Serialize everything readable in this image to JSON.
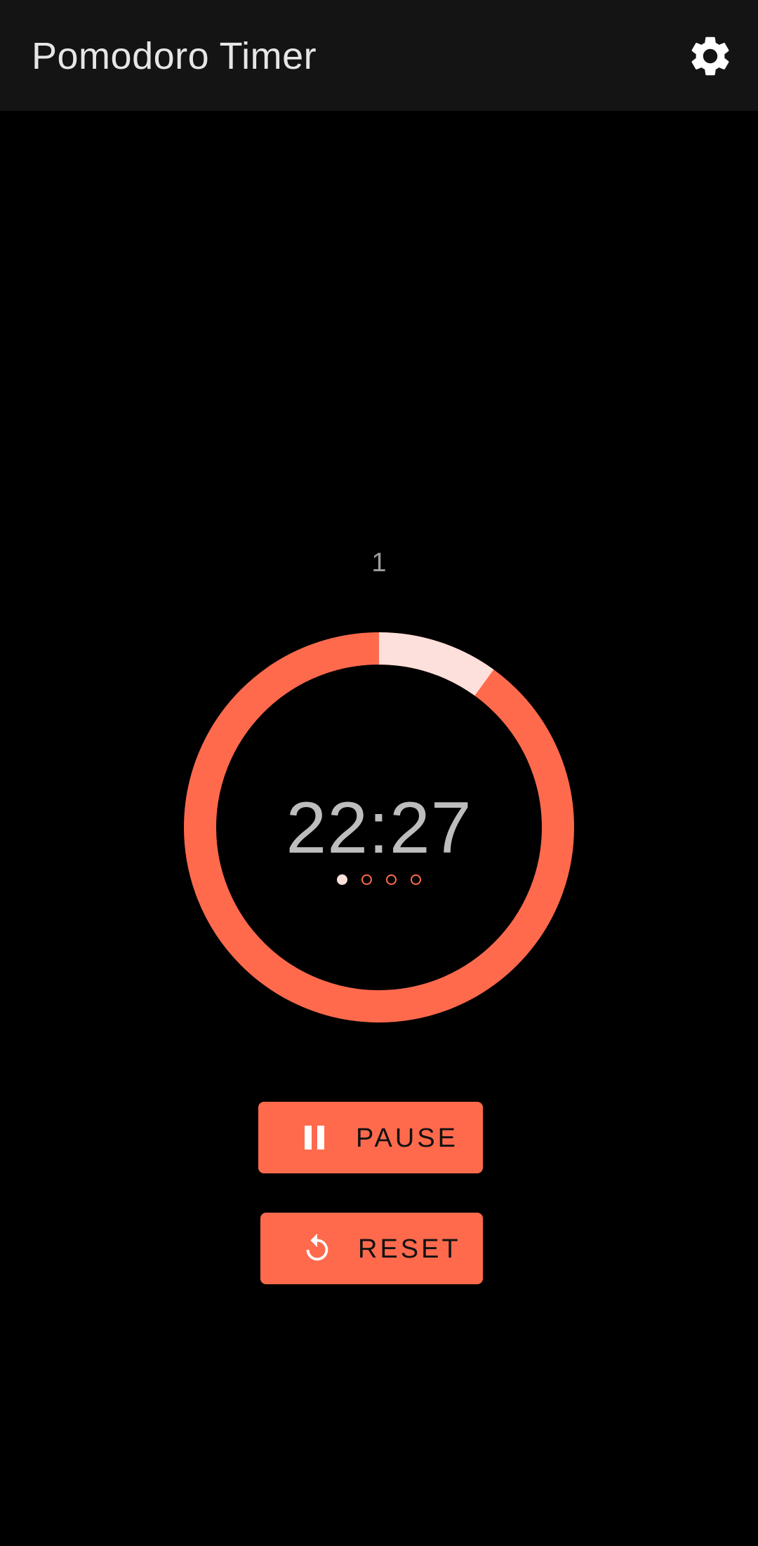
{
  "app": {
    "title": "Pomodoro Timer"
  },
  "icons": {
    "settings": "gear-icon",
    "pause": "pause-icon",
    "reset": "refresh-icon"
  },
  "timer": {
    "session_number": "1",
    "time_remaining": "22:27",
    "elapsed_fraction": 0.1,
    "session_dots": [
      {
        "active": true
      },
      {
        "active": false
      },
      {
        "active": false
      },
      {
        "active": false
      }
    ]
  },
  "controls": {
    "pause_label": "PAUSE",
    "reset_label": "RESET"
  },
  "colors": {
    "accent": "#ff6a4d",
    "elapsed": "#fde0db",
    "topbar": "#141414",
    "background": "#000000",
    "time_text": "#bdbdbd"
  }
}
